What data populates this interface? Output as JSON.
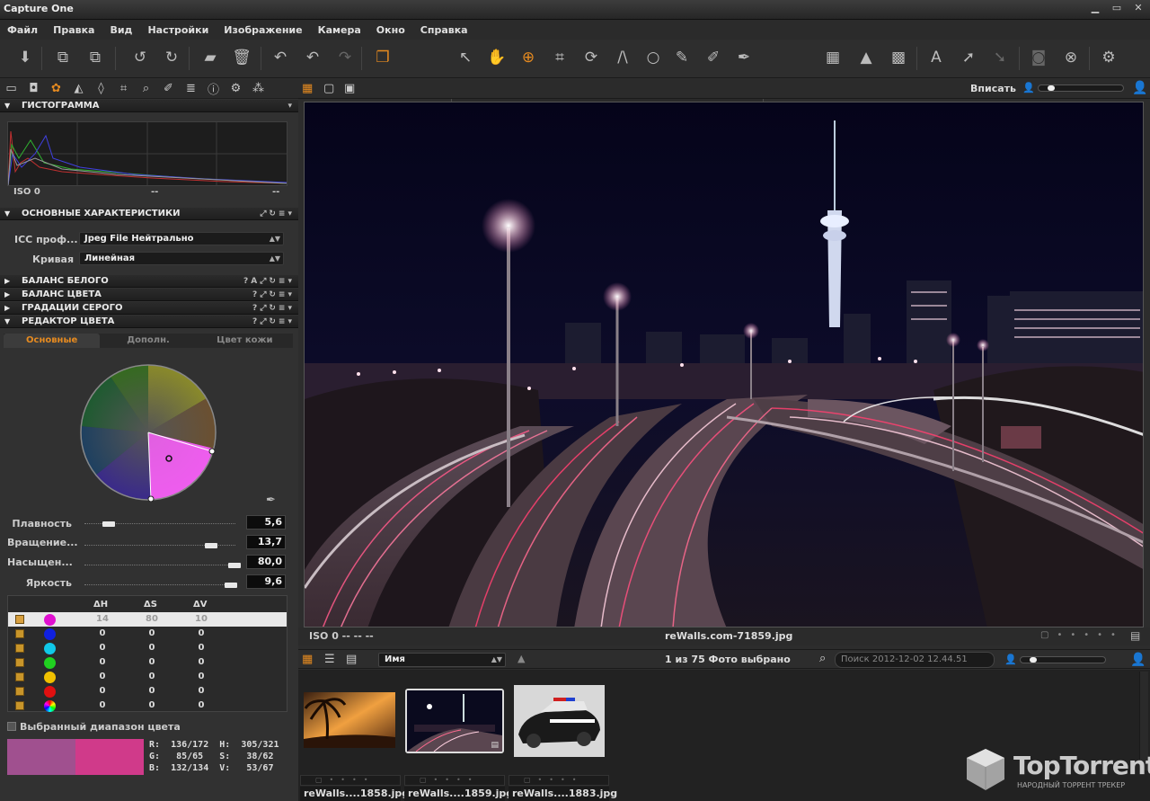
{
  "app": {
    "title": "Capture One"
  },
  "menu": [
    "Файл",
    "Правка",
    "Вид",
    "Настройки",
    "Изображение",
    "Камера",
    "Окно",
    "Справка"
  ],
  "tool_tabs": [
    "folder-icon",
    "camera-icon",
    "color-icon",
    "exposure-icon",
    "lens-icon",
    "crop-icon",
    "focus-icon",
    "adjust-icon",
    "metadata-icon",
    "info-icon",
    "gear-icon",
    "batch-icon"
  ],
  "histogram": {
    "title": "ГИСТОГРАММА",
    "iso": "ISO 0",
    "v1": "--",
    "v2": "--"
  },
  "basic": {
    "title": "ОСНОВНЫЕ ХАРАКТЕРИСТИКИ",
    "icc_label": "ICC проф...",
    "icc_value": "Jpeg File Нейтрально",
    "curve_label": "Кривая",
    "curve_value": "Линейная"
  },
  "sections": [
    "БАЛАНС БЕЛОГО",
    "БАЛАНС ЦВЕТА",
    "ГРАДАЦИИ СЕРОГО",
    "РЕДАКТОР ЦВЕТА"
  ],
  "color_editor": {
    "tabs": [
      "Основные",
      "Дополн.",
      "Цвет кожи"
    ],
    "sliders": [
      {
        "label": "Плавность",
        "value": "5,6"
      },
      {
        "label": "Вращение...",
        "value": "13,7"
      },
      {
        "label": "Насыщен...",
        "value": "80,0"
      },
      {
        "label": "Яркость",
        "value": "9,6"
      }
    ],
    "table_headers": [
      "ΔH",
      "ΔS",
      "ΔV"
    ],
    "rows": [
      {
        "color": "#e010d0",
        "h": "14",
        "s": "80",
        "v": "10"
      },
      {
        "color": "#1020e0",
        "h": "0",
        "s": "0",
        "v": "0"
      },
      {
        "color": "#10c8e8",
        "h": "0",
        "s": "0",
        "v": "0"
      },
      {
        "color": "#20d020",
        "h": "0",
        "s": "0",
        "v": "0"
      },
      {
        "color": "#f0c000",
        "h": "0",
        "s": "0",
        "v": "0"
      },
      {
        "color": "#e01010",
        "h": "0",
        "s": "0",
        "v": "0"
      },
      {
        "color": "#ffffff",
        "h": "0",
        "s": "0",
        "v": "0"
      }
    ],
    "selected_range_label": "Выбранный диапазон цвета",
    "swatch_before": "#a0508f",
    "swatch_after": "#d03a8a",
    "rgb_values": "R:  136/172  H:  305/321\nG:   85/65   S:   38/62\nB:  132/134  V:   53/67"
  },
  "viewer": {
    "fit_label": "Вписать",
    "iso_status": "ISO 0  -- -- --",
    "filename": "reWalls.com-71859.jpg"
  },
  "browser": {
    "sort": "Имя",
    "count": "1 из 75 Фото выбрано",
    "search_placeholder": "Поиск 2012-12-02 12.44.51",
    "thumbs": [
      "reWalls....1858.jpg",
      "reWalls....1859.jpg",
      "reWalls....1883.jpg"
    ]
  },
  "watermark": {
    "name": "TopTorrent",
    "sub": "НАРОДНЫЙ ТОРРЕНТ ТРЕКЕР"
  },
  "colors": {
    "accent": "#e58a20"
  }
}
